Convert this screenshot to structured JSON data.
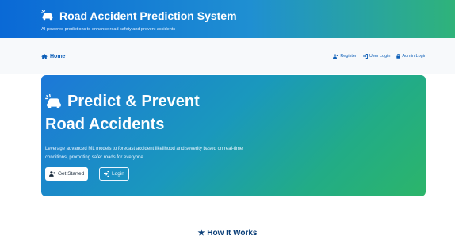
{
  "header": {
    "title": "Road Accident Prediction System",
    "subtitle": "AI-powered predictions to enhance road safety and prevent accidents",
    "icon": "car-crash-icon"
  },
  "nav": {
    "home_label": "Home",
    "home_icon": "home-icon",
    "register_label": "Register",
    "user_login_label": "User Login",
    "admin_login_label": "Admin Login"
  },
  "hero": {
    "title_line1": "Predict & Prevent",
    "title_line2": "Road Accidents",
    "description": "Leverage advanced ML models to forecast accident likelihood and severity based on real-time conditions, promoting safer roads for everyone.",
    "get_started_label": "Get Started",
    "login_label": "Login"
  },
  "section": {
    "how_it_works": "How It Works"
  },
  "colors": {
    "header_gradient_start": "#0a69d6",
    "header_gradient_end": "#2fb37a",
    "hero_gradient_start": "#1c78d8",
    "hero_gradient_end": "#2cb56a",
    "link": "#0d5fb8"
  }
}
